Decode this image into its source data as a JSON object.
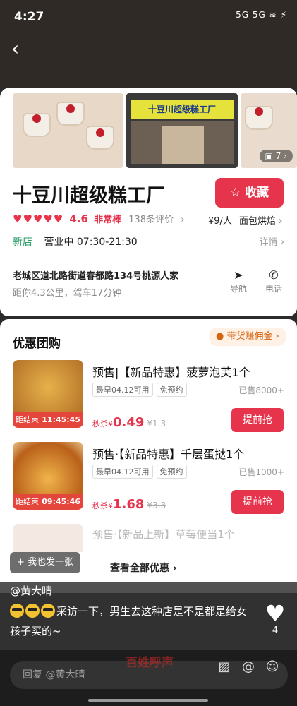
{
  "status_bar": {
    "time": "4:27",
    "indicators": "5G 5G"
  },
  "store": {
    "name": "十豆川超级糕工厂",
    "favorite_label": "收藏",
    "rating_score": "4.6",
    "rating_word": "非常棒",
    "reviews": "138条评价",
    "price": "¥9/人",
    "category": "面包烘焙",
    "new_tag": "新店",
    "hours": "营业中 07:30-21:30",
    "details": "详情",
    "address": "老城区道北路街道春都路134号桃源人家",
    "distance": "距你4.3公里，驾车17分钟",
    "nav_label": "导航",
    "call_label": "电话",
    "photo_count": "7",
    "sign_text": "十豆川超级糕工厂"
  },
  "deals": {
    "title": "优惠团购",
    "commission": "带货赚佣金",
    "items": [
      {
        "title": "预售|【新品特惠】菠萝泡芙1个",
        "tag1": "最早04.12可用",
        "tag2": "免预约",
        "sold": "已售8000+",
        "price_prefix": "秒杀¥",
        "price": "0.49",
        "orig": "¥1.3",
        "timer_label": "距结束",
        "timer": "11:45:45",
        "button": "提前抢"
      },
      {
        "title": "预售·【新品特惠】千层蛋挞1个",
        "tag1": "最早04.12可用",
        "tag2": "免预约",
        "sold": "已售1000+",
        "price_prefix": "秒杀¥",
        "price": "1.68",
        "orig": "¥3.3",
        "timer_label": "距结束",
        "timer": "09:45:46",
        "button": "提前抢"
      },
      {
        "title": "预售·【新品上新】草莓便当1个"
      }
    ],
    "view_all": "查看全部优惠 ›",
    "me_too": "+ 我也发一张"
  },
  "post": {
    "author": "@黄大晴",
    "caption": "采访一下，男生去这种店是不是都是给女孩子买的~",
    "likes": "4"
  },
  "watermark": "百姓呼声",
  "reply": {
    "placeholder": "回复 @黄大晴"
  },
  "colors": {
    "accent": "#e6344c",
    "green": "#2a9d64",
    "commission": "#d4640f"
  }
}
